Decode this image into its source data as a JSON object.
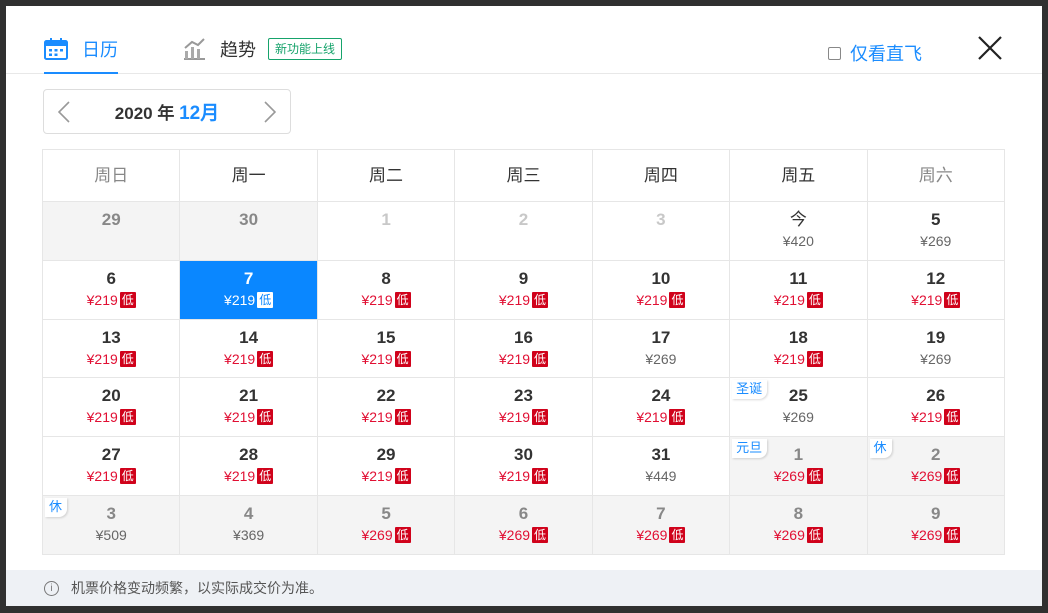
{
  "tabs": {
    "calendar_label": "日历",
    "trend_label": "趋势",
    "new_badge": "新功能上线"
  },
  "direct_only_label": "仅看直飞",
  "month_nav": {
    "year": "2020",
    "year_suffix": "年",
    "month": "12月"
  },
  "weekdays": [
    "周日",
    "周一",
    "周二",
    "周三",
    "周四",
    "周五",
    "周六"
  ],
  "weeks": [
    [
      {
        "day": "29",
        "price": "",
        "low": false,
        "state": "gray"
      },
      {
        "day": "30",
        "price": "",
        "low": false,
        "state": "gray"
      },
      {
        "day": "1",
        "price": "",
        "low": false,
        "state": "muted"
      },
      {
        "day": "2",
        "price": "",
        "low": false,
        "state": "muted"
      },
      {
        "day": "3",
        "price": "",
        "low": false,
        "state": "muted"
      },
      {
        "day": "今",
        "price": "¥420",
        "low": false,
        "state": "today"
      },
      {
        "day": "5",
        "price": "¥269",
        "low": false,
        "state": "normal"
      }
    ],
    [
      {
        "day": "6",
        "price": "¥219",
        "low": true,
        "state": "normal"
      },
      {
        "day": "7",
        "price": "¥219",
        "low": true,
        "state": "selected"
      },
      {
        "day": "8",
        "price": "¥219",
        "low": true,
        "state": "normal"
      },
      {
        "day": "9",
        "price": "¥219",
        "low": true,
        "state": "normal"
      },
      {
        "day": "10",
        "price": "¥219",
        "low": true,
        "state": "normal"
      },
      {
        "day": "11",
        "price": "¥219",
        "low": true,
        "state": "normal"
      },
      {
        "day": "12",
        "price": "¥219",
        "low": true,
        "state": "normal"
      }
    ],
    [
      {
        "day": "13",
        "price": "¥219",
        "low": true,
        "state": "normal"
      },
      {
        "day": "14",
        "price": "¥219",
        "low": true,
        "state": "normal"
      },
      {
        "day": "15",
        "price": "¥219",
        "low": true,
        "state": "normal"
      },
      {
        "day": "16",
        "price": "¥219",
        "low": true,
        "state": "normal"
      },
      {
        "day": "17",
        "price": "¥269",
        "low": false,
        "state": "normal"
      },
      {
        "day": "18",
        "price": "¥219",
        "low": true,
        "state": "normal"
      },
      {
        "day": "19",
        "price": "¥269",
        "low": false,
        "state": "normal"
      }
    ],
    [
      {
        "day": "20",
        "price": "¥219",
        "low": true,
        "state": "normal"
      },
      {
        "day": "21",
        "price": "¥219",
        "low": true,
        "state": "normal"
      },
      {
        "day": "22",
        "price": "¥219",
        "low": true,
        "state": "normal"
      },
      {
        "day": "23",
        "price": "¥219",
        "low": true,
        "state": "normal"
      },
      {
        "day": "24",
        "price": "¥219",
        "low": true,
        "state": "normal"
      },
      {
        "day": "25",
        "price": "¥269",
        "low": false,
        "state": "normal",
        "holiday": "圣诞"
      },
      {
        "day": "26",
        "price": "¥219",
        "low": true,
        "state": "normal"
      }
    ],
    [
      {
        "day": "27",
        "price": "¥219",
        "low": true,
        "state": "normal"
      },
      {
        "day": "28",
        "price": "¥219",
        "low": true,
        "state": "normal"
      },
      {
        "day": "29",
        "price": "¥219",
        "low": true,
        "state": "normal"
      },
      {
        "day": "30",
        "price": "¥219",
        "low": true,
        "state": "normal"
      },
      {
        "day": "31",
        "price": "¥449",
        "low": false,
        "state": "normal"
      },
      {
        "day": "1",
        "price": "¥269",
        "low": true,
        "state": "gray",
        "holiday": "元旦"
      },
      {
        "day": "2",
        "price": "¥269",
        "low": true,
        "state": "gray",
        "holiday": "休"
      }
    ],
    [
      {
        "day": "3",
        "price": "¥509",
        "low": false,
        "state": "gray",
        "holiday": "休"
      },
      {
        "day": "4",
        "price": "¥369",
        "low": false,
        "state": "gray"
      },
      {
        "day": "5",
        "price": "¥269",
        "low": true,
        "state": "gray"
      },
      {
        "day": "6",
        "price": "¥269",
        "low": true,
        "state": "gray"
      },
      {
        "day": "7",
        "price": "¥269",
        "low": true,
        "state": "gray"
      },
      {
        "day": "8",
        "price": "¥269",
        "low": true,
        "state": "gray"
      },
      {
        "day": "9",
        "price": "¥269",
        "low": true,
        "state": "gray"
      }
    ]
  ],
  "low_tag": "低",
  "footer_note": "机票价格变动频繁，以实际成交价为准。",
  "colors": {
    "accent": "#1a8cff",
    "selected_bg": "#0a87ff",
    "low_price": "#e10f33",
    "low_tag_bg": "#d0021b",
    "badge_green": "#16a36b"
  }
}
